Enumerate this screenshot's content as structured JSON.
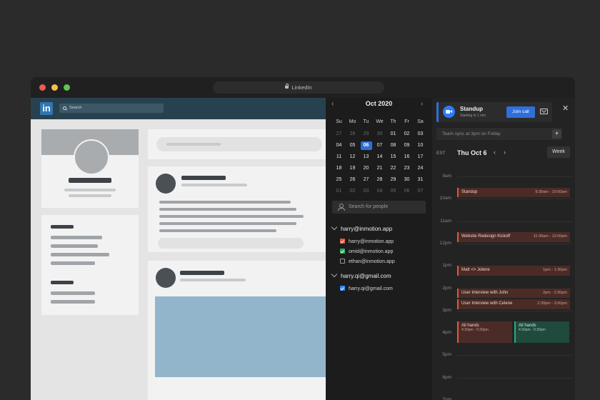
{
  "window": {
    "title": "LinkedIn"
  },
  "linkedin": {
    "logo": "in",
    "search_placeholder": "Search"
  },
  "calendar": {
    "month": "Oct 2020",
    "weekdays": [
      "Su",
      "Mo",
      "Tu",
      "We",
      "Th",
      "Fr",
      "Sa"
    ],
    "weeks": [
      [
        "27",
        "28",
        "29",
        "30",
        "01",
        "02",
        "03"
      ],
      [
        "04",
        "05",
        "06",
        "07",
        "08",
        "09",
        "10"
      ],
      [
        "11",
        "12",
        "13",
        "14",
        "15",
        "16",
        "17"
      ],
      [
        "18",
        "19",
        "20",
        "21",
        "22",
        "23",
        "24"
      ],
      [
        "25",
        "26",
        "27",
        "28",
        "29",
        "30",
        "31"
      ],
      [
        "01",
        "02",
        "03",
        "04",
        "05",
        "06",
        "07"
      ]
    ],
    "selected_day": "06",
    "people_search_placeholder": "Search for people",
    "accounts": [
      {
        "name": "harry@inmotion.app",
        "calendars": [
          {
            "label": "harry@inmotion.app",
            "checked": true,
            "color": "#e2583f"
          },
          {
            "label": "omid@inmotion.app",
            "checked": true,
            "color": "#27ae60"
          },
          {
            "label": "ethan@inmotion.app",
            "checked": false,
            "color": ""
          }
        ]
      },
      {
        "name": "harry.qi@gmail.com",
        "calendars": [
          {
            "label": "harry.qi@gmail.com",
            "checked": true,
            "color": "#2d8cf0"
          }
        ]
      }
    ]
  },
  "meeting": {
    "title": "Standup",
    "subtitle": "Starting in 1 min",
    "join_label": "Join call",
    "note_placeholder": "Team sync at 3pm on Friday"
  },
  "day_view": {
    "timezone": "EST",
    "date": "Thu Oct 6",
    "view_label": "Week",
    "hours": [
      "9am",
      "10am",
      "11am",
      "12pm",
      "1pm",
      "2pm",
      "3pm",
      "4pm",
      "5pm",
      "6pm",
      "7pm"
    ],
    "events": [
      {
        "title": "Standup",
        "time": "9:30am - 10:00am",
        "start": 9.5,
        "end": 10.0
      },
      {
        "title": "Website Redesign Kickoff",
        "time": "11:30am - 12:00pm",
        "start": 11.5,
        "end": 12.0
      },
      {
        "title": "Matt <> Jolene",
        "time": "1pm - 1:30pm",
        "start": 13.0,
        "end": 13.5
      },
      {
        "title": "User Interview with John",
        "time": "2pm - 2:30pm",
        "start": 14.0,
        "end": 14.5
      },
      {
        "title": "User Interview with Celene",
        "time": "2:30pm - 3:00pm",
        "start": 14.5,
        "end": 15.0
      },
      {
        "title": "All hands",
        "sub": "4:30pm - 5:30pm",
        "start": 15.5,
        "end": 16.5,
        "column": 0
      },
      {
        "title": "All hands",
        "sub": "4:30pm - 5:30pm",
        "start": 15.5,
        "end": 16.5,
        "column": 1,
        "color": "green"
      }
    ]
  }
}
